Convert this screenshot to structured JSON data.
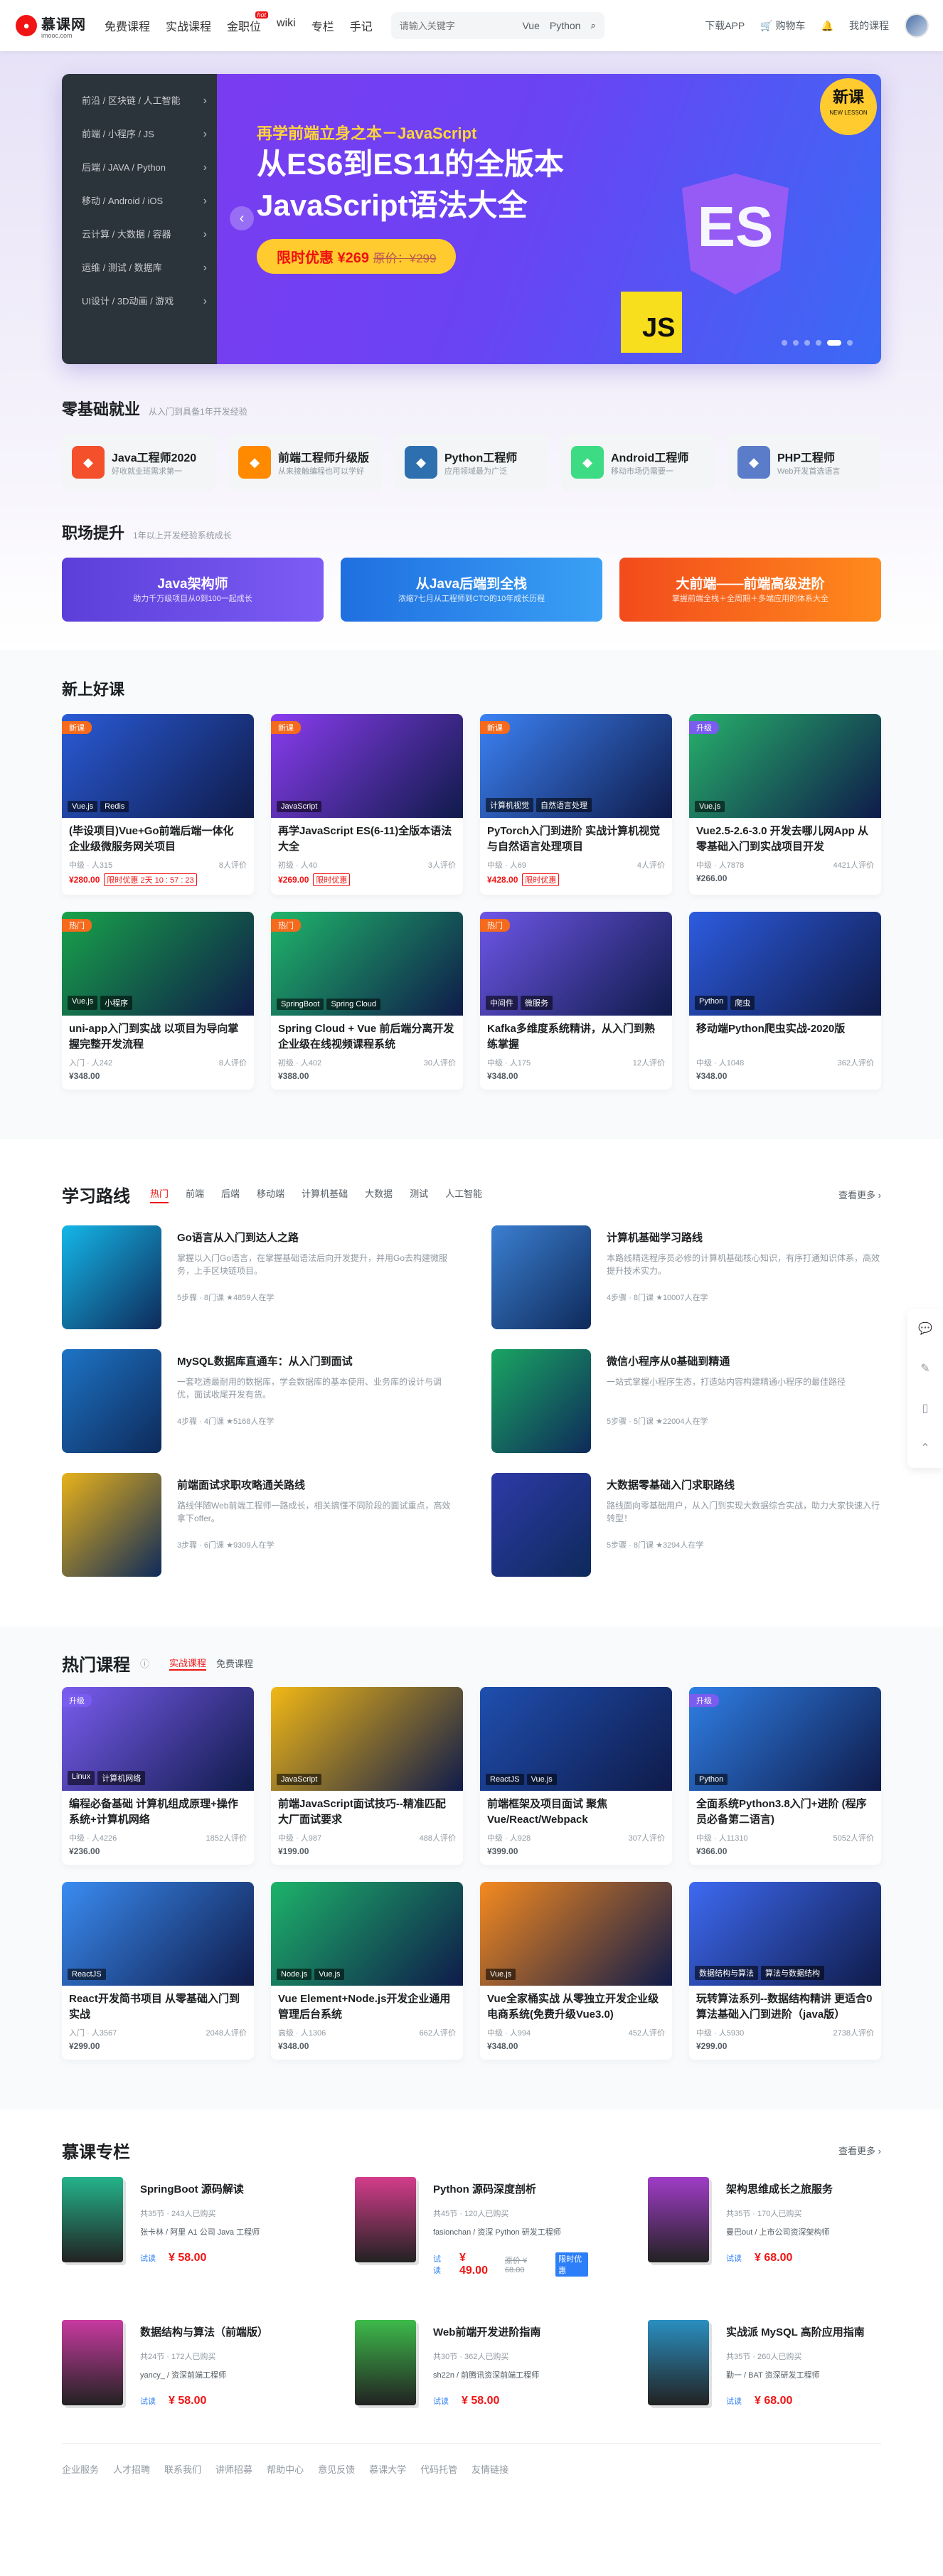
{
  "header": {
    "logo_cn": "慕课网",
    "logo_en": "imooc.com",
    "nav": [
      "免费课程",
      "实战课程",
      "金职位",
      "wiki",
      "专栏",
      "手记"
    ],
    "hot_badge": "hot",
    "search_placeholder": "请输入关键字",
    "search_keywords": [
      "Vue",
      "Python"
    ],
    "download_app": "下载APP",
    "cart": "购物车",
    "my_courses": "我的课程"
  },
  "banner": {
    "categories": [
      "前沿 / 区块链 / 人工智能",
      "前端 / 小程序 / JS",
      "后端 / JAVA / Python",
      "移动 / Android / iOS",
      "云计算 / 大数据 / 容器",
      "运维 / 测试 / 数据库",
      "UI设计 / 3D动画 / 游戏"
    ],
    "subtitle": "再学前端立身之本－JavaScript",
    "title": "从ES6到ES11的全版本 JavaScript语法大全",
    "price": "限时优惠 ¥269",
    "original_price": "原价：¥299",
    "new_tag": "新课",
    "new_tag_en": "NEW LESSON",
    "js_badge": "JS",
    "shield": "ES"
  },
  "zero": {
    "title": "零基础就业",
    "desc": "从入门到具备1年开发经验",
    "items": [
      {
        "name": "Java工程师2020",
        "desc": "好收就业班需求第一",
        "icon": "java-icon",
        "color": "#f4502c"
      },
      {
        "name": "前端工程师升级版",
        "desc": "从来接触编程也可以学好",
        "icon": "html5-icon",
        "color": "#ff8a00"
      },
      {
        "name": "Python工程师",
        "desc": "应用领域最为广泛",
        "icon": "python-icon",
        "color": "#2e6fb0"
      },
      {
        "name": "Android工程师",
        "desc": "移动市场仍需要一",
        "icon": "android-icon",
        "color": "#3ddc84"
      },
      {
        "name": "PHP工程师",
        "desc": "Web开发首选语言",
        "icon": "php-icon",
        "color": "#5b7cc8"
      }
    ]
  },
  "career": {
    "title": "职场提升",
    "desc": "1年以上开发经验系统成长",
    "items": [
      {
        "name": "Java架构师",
        "desc": "助力千万级项目从0到100一起成长"
      },
      {
        "name": "从Java后端到全栈",
        "desc": "浓缩7七月从工程师到CTO的10年成长历程"
      },
      {
        "name": "大前端——前端高级进阶",
        "desc": "掌握前端全栈＋全周期＋多端应用的体系大全"
      }
    ]
  },
  "new_courses": {
    "title": "新上好课",
    "items": [
      {
        "tag": "新课",
        "labels": [
          "Vue.js",
          "Redis"
        ],
        "title": "(毕设项目)Vue+Go前端后端一体化 企业级微服务网关项目",
        "level": "中级",
        "learners": "人315",
        "reviews": "8人评价",
        "price": "¥280.00",
        "promo": "限时优惠 2天 10 : 57 : 23",
        "color": "#2a5bd7"
      },
      {
        "tag": "新课",
        "labels": [
          "JavaScript"
        ],
        "title": "再学JavaScript ES(6-11)全版本语法大全",
        "level": "初级",
        "learners": "人40",
        "reviews": "3人评价",
        "price": "¥269.00",
        "promo": "限时优惠",
        "color": "#8a3cf0"
      },
      {
        "tag": "新课",
        "labels": [
          "计算机视觉",
          "自然语言处理"
        ],
        "title": "PyTorch入门到进阶 实战计算机视觉与自然语言处理项目",
        "level": "中级",
        "learners": "人69",
        "reviews": "4人评价",
        "price": "¥428.00",
        "promo": "限时优惠",
        "color": "#3c82f5"
      },
      {
        "tag": "升级",
        "labels": [
          "Vue.js"
        ],
        "title": "Vue2.5-2.6-3.0 开发去哪儿网App 从零基础入门到实战项目开发",
        "level": "中级",
        "learners": "人7878",
        "reviews": "4421人评价",
        "price": "¥266.00",
        "promo": "",
        "color": "#27b16b"
      },
      {
        "tag": "热门",
        "labels": [
          "Vue.js",
          "小程序"
        ],
        "title": "uni-app入门到实战 以项目为导向掌握完整开发流程",
        "level": "入门",
        "learners": "人242",
        "reviews": "8人评价",
        "price": "¥348.00",
        "promo": "",
        "color": "#18a34a"
      },
      {
        "tag": "热门",
        "labels": [
          "SpringBoot",
          "Spring Cloud"
        ],
        "title": "Spring Cloud + Vue 前后端分离开发企业级在线视频课程系统",
        "level": "初级",
        "learners": "人402",
        "reviews": "30人评价",
        "price": "¥388.00",
        "promo": "",
        "color": "#1fb66a"
      },
      {
        "tag": "热门",
        "labels": [
          "中间件",
          "微服务"
        ],
        "title": "Kafka多维度系统精讲，从入门到熟练掌握",
        "level": "中级",
        "learners": "人175",
        "reviews": "12人评价",
        "price": "¥348.00",
        "promo": "",
        "color": "#6e56e8"
      },
      {
        "tag": "",
        "labels": [
          "Python",
          "爬虫"
        ],
        "title": "移动端Python爬虫实战-2020版",
        "level": "中级",
        "learners": "人1048",
        "reviews": "362人评价",
        "price": "¥348.00",
        "promo": "",
        "color": "#2d5ce0"
      }
    ]
  },
  "routes": {
    "title": "学习路线",
    "tabs": [
      "热门",
      "前端",
      "后端",
      "移动端",
      "计算机基础",
      "大数据",
      "测试",
      "人工智能"
    ],
    "more": "查看更多 ›",
    "items": [
      {
        "title": "Go语言从入门到达人之路",
        "desc": "掌握以入门Go语言，在掌握基础语法后向开发提升，并用Go去构建微服务，上手区块链项目。",
        "meta": "5步骤 · 8门课",
        "count": "★4859人在学",
        "color": "#14b7e8"
      },
      {
        "title": "计算机基础学习路线",
        "desc": "本路线精选程序员必修的计算机基础核心知识，有序打通知识体系，高效提升技术实力。",
        "meta": "4步骤 · 8门课",
        "count": "★10007人在学",
        "color": "#3b7fd1"
      },
      {
        "title": "MySQL数据库直通车：从入门到面试",
        "desc": "一套吃透最耐用的数据库，学会数据库的基本使用、业务库的设计与调优，面试收尾开发有货。",
        "meta": "4步骤 · 4门课",
        "count": "★5168人在学",
        "color": "#1d74c6"
      },
      {
        "title": "微信小程序从0基础到精通",
        "desc": "一站式掌握小程序生态，打造站内容构建精通小程序的最佳路径",
        "meta": "5步骤 · 5门课",
        "count": "★22004人在学",
        "color": "#1aa562"
      },
      {
        "title": "前端面试求职攻略通关路线",
        "desc": "路线伴随Web前端工程师一路成长，相关搞懂不同阶段的面试重点，高效拿下offer。",
        "meta": "3步骤 · 6门课",
        "count": "★9309人在学",
        "color": "#e8b21a"
      },
      {
        "title": "大数据零基础入门求职路线",
        "desc": "路线面向零基础用户，从入门到实现大数据综合实战，助力大家快速入行转型！",
        "meta": "5步骤 · 8门课",
        "count": "★3294人在学",
        "color": "#2d3aa8"
      }
    ]
  },
  "hot_courses": {
    "title": "热门课程",
    "tabs": [
      "实战课程",
      "免费课程"
    ],
    "items": [
      {
        "tag": "升级",
        "labels": [
          "Linux",
          "计算机网络"
        ],
        "title": "编程必备基础 计算机组成原理+操作系统+计算机网络",
        "level": "中级",
        "learners": "人4226",
        "reviews": "1852人评价",
        "price": "¥236.00",
        "color": "#7a5cf0"
      },
      {
        "tag": "",
        "labels": [
          "JavaScript"
        ],
        "title": "前端JavaScript面试技巧--精准匹配大厂面试要求",
        "level": "中级",
        "learners": "人987",
        "reviews": "488人评价",
        "price": "¥199.00",
        "color": "#f2b815"
      },
      {
        "tag": "",
        "labels": [
          "ReactJS",
          "Vue.js"
        ],
        "title": "前端框架及项目面试 聚焦Vue/React/Webpack",
        "level": "中级",
        "learners": "人928",
        "reviews": "307人评价",
        "price": "¥399.00",
        "color": "#1f4fb0"
      },
      {
        "tag": "升级",
        "labels": [
          "Python"
        ],
        "title": "全面系统Python3.8入门+进阶 (程序员必备第二语言)",
        "level": "中级",
        "learners": "人11310",
        "reviews": "5052人评价",
        "price": "¥366.00",
        "color": "#2f7fe6"
      },
      {
        "tag": "",
        "labels": [
          "ReactJS"
        ],
        "title": "React开发简书项目 从零基础入门到实战",
        "level": "入门",
        "learners": "人3567",
        "reviews": "2048人评价",
        "price": "¥299.00",
        "color": "#3a8cf2"
      },
      {
        "tag": "",
        "labels": [
          "Node.js",
          "Vue.js"
        ],
        "title": "Vue Element+Node.js开发企业通用管理后台系统",
        "level": "高级",
        "learners": "人1306",
        "reviews": "662人评价",
        "price": "¥348.00",
        "color": "#1db36a"
      },
      {
        "tag": "",
        "labels": [
          "Vue.js"
        ],
        "title": "Vue全家桶实战 从零独立开发企业级电商系统(免费升级Vue3.0)",
        "level": "中级",
        "learners": "人994",
        "reviews": "452人评价",
        "price": "¥348.00",
        "color": "#f58a1f"
      },
      {
        "tag": "",
        "labels": [
          "数据结构与算法",
          "算法与数据结构"
        ],
        "title": "玩转算法系列--数据结构精讲 更适合0算法基础入门到进阶（java版）",
        "level": "中级",
        "learners": "人5930",
        "reviews": "2738人评价",
        "price": "¥299.00",
        "color": "#3e6af2"
      }
    ]
  },
  "columns": {
    "title": "慕课专栏",
    "more": "查看更多 ›",
    "items": [
      {
        "title": "SpringBoot 源码解读",
        "stats": "共35节 · 243人已购买",
        "author": "张卡林 / 阿里 A1 公司 Java 工程师",
        "trial": "试读",
        "price": "¥ 58.00",
        "old": "",
        "promo": "",
        "color": "#23b38a"
      },
      {
        "title": "Python 源码深度剖析",
        "stats": "共45节 · 120人已购买",
        "author": "fasionchan / 资深 Python 研发工程师",
        "trial": "试读",
        "price": "¥ 49.00",
        "old": "原价 ¥ 68.00",
        "promo": "限时优惠",
        "color": "#d33c8a"
      },
      {
        "title": "架构思维成长之旅服务",
        "stats": "共35节 · 170人已购买",
        "author": "曼巴out / 上市公司资深架构师",
        "trial": "试读",
        "price": "¥ 68.00",
        "old": "",
        "promo": "",
        "color": "#a03cc7"
      },
      {
        "title": "数据结构与算法（前端版）",
        "stats": "共24节 · 172人已购买",
        "author": "yancy_ / 资深前端工程师",
        "trial": "试读",
        "price": "¥ 58.00",
        "old": "",
        "promo": "",
        "color": "#c83aa0"
      },
      {
        "title": "Web前端开发进阶指南",
        "stats": "共30节 · 362人已购买",
        "author": "sh22n / 前腾讯资深前端工程师",
        "trial": "试读",
        "price": "¥ 58.00",
        "old": "",
        "promo": "",
        "color": "#3dba4a"
      },
      {
        "title": "实战派 MySQL 高阶应用指南",
        "stats": "共35节 · 260人已购买",
        "author": "勤一 / BAT 资深研发工程师",
        "trial": "试读",
        "price": "¥ 68.00",
        "old": "",
        "promo": "",
        "color": "#2a8fc0"
      }
    ]
  },
  "footer": [
    "企业服务",
    "人才招聘",
    "联系我们",
    "讲师招募",
    "帮助中心",
    "意见反馈",
    "慕课大学",
    "代码托管",
    "友情链接"
  ]
}
